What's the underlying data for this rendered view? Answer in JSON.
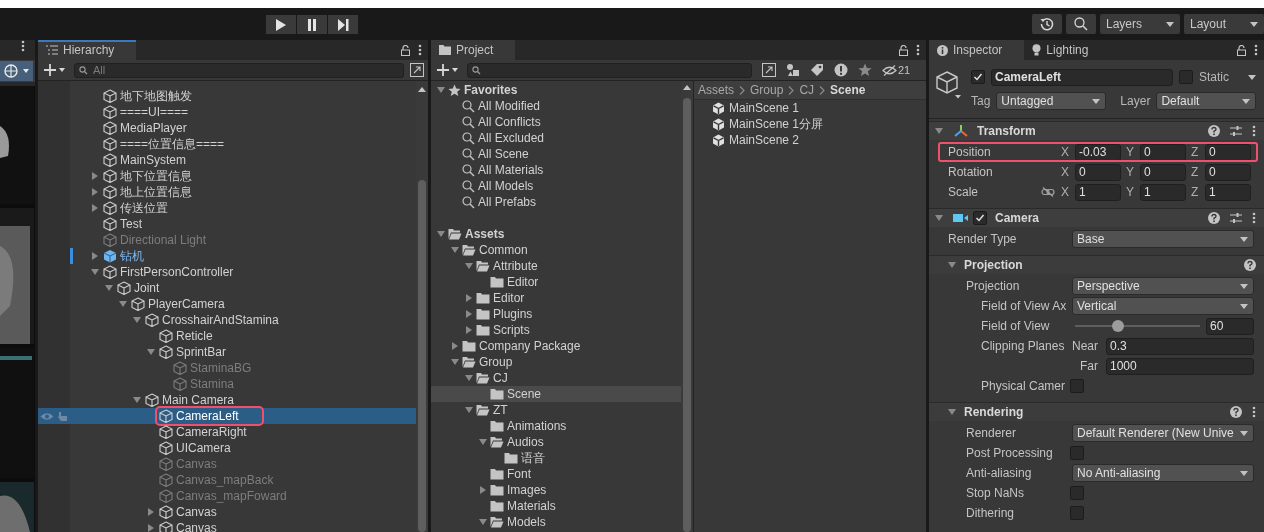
{
  "toolbar": {
    "play_buttons": [
      {
        "kind": "play",
        "selected": false
      },
      {
        "kind": "pause",
        "selected": false
      },
      {
        "kind": "step",
        "selected": false
      }
    ],
    "dropdowns": [
      "Layers",
      "Layout"
    ]
  },
  "hierarchy": {
    "title": "Hierarchy",
    "search": {
      "placeholder": "All"
    },
    "items": [
      {
        "name": "地下地图触发",
        "kind": "object",
        "disabled": false,
        "selected": false,
        "highlighted": false
      },
      {
        "name": "====UI====",
        "kind": "object",
        "disabled": false,
        "selected": false,
        "highlighted": false
      },
      {
        "name": "MediaPlayer",
        "kind": "object",
        "disabled": false,
        "selected": false,
        "highlighted": false
      },
      {
        "name": "====位置信息====",
        "kind": "object",
        "disabled": false,
        "selected": false,
        "highlighted": false
      },
      {
        "name": "MainSystem",
        "kind": "object",
        "disabled": false,
        "selected": false,
        "highlighted": false
      },
      {
        "name": "地下位置信息",
        "kind": "object",
        "expanded": false,
        "disabled": false,
        "selected": false,
        "highlighted": false
      },
      {
        "name": "地上位置信息",
        "kind": "object",
        "expanded": false,
        "disabled": false,
        "selected": false,
        "highlighted": false
      },
      {
        "name": "传送位置",
        "kind": "object",
        "expanded": false,
        "disabled": false,
        "selected": false,
        "highlighted": false
      },
      {
        "name": "Test",
        "kind": "object",
        "disabled": false,
        "selected": false,
        "highlighted": false
      },
      {
        "name": "Directional Light",
        "kind": "object",
        "disabled": true,
        "selected": false,
        "highlighted": false
      },
      {
        "name": "钻机",
        "kind": "prefab",
        "expanded": false,
        "disabled": false,
        "selected": false,
        "highlighted": false
      },
      {
        "name": "FirstPersonController",
        "kind": "object",
        "expanded": true,
        "disabled": false,
        "selected": false,
        "highlighted": false,
        "children": [
          {
            "name": "Joint",
            "kind": "object",
            "expanded": true,
            "disabled": false,
            "selected": false,
            "highlighted": false,
            "children": [
              {
                "name": "PlayerCamera",
                "kind": "object",
                "expanded": true,
                "disabled": false,
                "selected": false,
                "highlighted": false,
                "children": [
                  {
                    "name": "CrosshairAndStamina",
                    "kind": "object",
                    "expanded": true,
                    "disabled": false,
                    "selected": false,
                    "highlighted": false,
                    "children": [
                      {
                        "name": "Reticle",
                        "kind": "object",
                        "disabled": false,
                        "selected": false,
                        "highlighted": false
                      },
                      {
                        "name": "SprintBar",
                        "kind": "object",
                        "expanded": true,
                        "disabled": false,
                        "selected": false,
                        "highlighted": false,
                        "children": [
                          {
                            "name": "StaminaBG",
                            "kind": "object",
                            "disabled": true,
                            "selected": false,
                            "highlighted": false
                          },
                          {
                            "name": "Stamina",
                            "kind": "object",
                            "disabled": true,
                            "selected": false,
                            "highlighted": false
                          }
                        ]
                      }
                    ]
                  },
                  {
                    "name": "Main Camera",
                    "kind": "object",
                    "expanded": true,
                    "disabled": false,
                    "selected": false,
                    "highlighted": false,
                    "children": [
                      {
                        "name": "CameraLeft",
                        "kind": "object",
                        "disabled": false,
                        "selected": true,
                        "highlighted": true
                      },
                      {
                        "name": "CameraRight",
                        "kind": "object",
                        "disabled": false,
                        "selected": false,
                        "highlighted": false
                      },
                      {
                        "name": "UICamera",
                        "kind": "object",
                        "disabled": false,
                        "selected": false,
                        "highlighted": false
                      },
                      {
                        "name": "Canvas",
                        "kind": "object",
                        "disabled": true,
                        "selected": false,
                        "highlighted": false
                      },
                      {
                        "name": "Canvas_mapBack",
                        "kind": "object",
                        "disabled": true,
                        "selected": false,
                        "highlighted": false
                      },
                      {
                        "name": "Canvas_mapFoward",
                        "kind": "object",
                        "disabled": true,
                        "selected": false,
                        "highlighted": false
                      },
                      {
                        "name": "Canvas",
                        "kind": "object",
                        "expanded": false,
                        "disabled": false,
                        "selected": false,
                        "highlighted": false
                      },
                      {
                        "name": "Canvas",
                        "kind": "object",
                        "expanded": false,
                        "disabled": false,
                        "selected": false,
                        "highlighted": false
                      }
                    ]
                  }
                ]
              }
            ]
          }
        ]
      }
    ]
  },
  "project": {
    "title": "Project",
    "hidden_count": "21",
    "tree": [
      {
        "name": "Favorites",
        "kind": "favorites",
        "expanded": true,
        "selected": false,
        "children": [
          {
            "name": "All Modified",
            "kind": "search",
            "selected": false
          },
          {
            "name": "All Conflicts",
            "kind": "search",
            "selected": false
          },
          {
            "name": "All Excluded",
            "kind": "search",
            "selected": false
          },
          {
            "name": "All Scene",
            "kind": "search",
            "selected": false
          },
          {
            "name": "All Materials",
            "kind": "search",
            "selected": false
          },
          {
            "name": "All Models",
            "kind": "search",
            "selected": false
          },
          {
            "name": "All Prefabs",
            "kind": "search",
            "selected": false
          }
        ]
      },
      {
        "name": "Assets",
        "kind": "folder",
        "expanded": true,
        "selected": false,
        "children": [
          {
            "name": "Common",
            "kind": "folder",
            "expanded": true,
            "selected": false,
            "children": [
              {
                "name": "Attribute",
                "kind": "folder",
                "expanded": true,
                "selected": false,
                "children": [
                  {
                    "name": "Editor",
                    "kind": "folder",
                    "selected": false
                  }
                ]
              },
              {
                "name": "Editor",
                "kind": "folder",
                "expanded": false,
                "selected": false
              },
              {
                "name": "Plugins",
                "kind": "folder",
                "expanded": false,
                "selected": false
              },
              {
                "name": "Scripts",
                "kind": "folder",
                "expanded": false,
                "selected": false
              }
            ]
          },
          {
            "name": "Company Package",
            "kind": "folder",
            "expanded": false,
            "selected": false
          },
          {
            "name": "Group",
            "kind": "folder",
            "expanded": true,
            "selected": false,
            "children": [
              {
                "name": "CJ",
                "kind": "folder",
                "expanded": true,
                "selected": false,
                "children": [
                  {
                    "name": "Scene",
                    "kind": "folder",
                    "selected": true
                  }
                ]
              },
              {
                "name": "ZT",
                "kind": "folder",
                "expanded": true,
                "selected": false,
                "children": [
                  {
                    "name": "Animations",
                    "kind": "folder",
                    "selected": false
                  },
                  {
                    "name": "Audios",
                    "kind": "folder",
                    "expanded": true,
                    "selected": false,
                    "children": [
                      {
                        "name": "语音",
                        "kind": "folder",
                        "selected": false
                      }
                    ]
                  },
                  {
                    "name": "Font",
                    "kind": "folder",
                    "selected": false
                  },
                  {
                    "name": "Images",
                    "kind": "folder",
                    "expanded": false,
                    "selected": false
                  },
                  {
                    "name": "Materials",
                    "kind": "folder",
                    "selected": false
                  },
                  {
                    "name": "Models",
                    "kind": "folder",
                    "expanded": true,
                    "selected": false
                  }
                ]
              }
            ]
          }
        ]
      }
    ],
    "breadcrumb": [
      "Assets",
      "Group",
      "CJ",
      "Scene"
    ],
    "files": [
      {
        "name": "MainScene 1",
        "kind": "scene"
      },
      {
        "name": "MainScene 1分屏",
        "kind": "scene"
      },
      {
        "name": "MainScene 2",
        "kind": "scene"
      }
    ]
  },
  "inspector": {
    "tabs": [
      {
        "label": "Inspector",
        "kind": "info",
        "selected": true
      },
      {
        "label": "Lighting",
        "kind": "light",
        "selected": false
      }
    ],
    "object": {
      "active": true,
      "name": "CameraLeft",
      "static": false,
      "static_label": "Static",
      "tag_label": "Tag",
      "tag": "Untagged",
      "layer_label": "Layer",
      "layer": "Default"
    },
    "sections": [
      {
        "kind": "transform",
        "title": "Transform",
        "menu": true,
        "rows": [
          {
            "kind": "vector",
            "label": "Position",
            "highlighted": true,
            "constrain_toggle": false,
            "fields": [
              {
                "axis": "X",
                "value": "-0.03"
              },
              {
                "axis": "Y",
                "value": "0"
              },
              {
                "axis": "Z",
                "value": "0"
              }
            ]
          },
          {
            "kind": "vector",
            "label": "Rotation",
            "highlighted": false,
            "constrain_toggle": false,
            "fields": [
              {
                "axis": "X",
                "value": "0"
              },
              {
                "axis": "Y",
                "value": "0"
              },
              {
                "axis": "Z",
                "value": "0"
              }
            ]
          },
          {
            "kind": "vector",
            "label": "Scale",
            "highlighted": false,
            "constrain_toggle": true,
            "fields": [
              {
                "axis": "X",
                "value": "1"
              },
              {
                "axis": "Y",
                "value": "1"
              },
              {
                "axis": "Z",
                "value": "1"
              }
            ]
          }
        ]
      },
      {
        "kind": "camera",
        "title": "Camera",
        "enabled": true,
        "menu": true,
        "rows": [
          {
            "kind": "dropdown",
            "label": "Render Type",
            "value": "Base"
          }
        ]
      },
      {
        "kind": "group",
        "title": "Projection",
        "menu": false,
        "rows": [
          {
            "kind": "dropdown",
            "label": "Projection",
            "value": "Perspective",
            "children": [
              {
                "kind": "dropdown",
                "label": "Field of View Ax",
                "value": "Vertical"
              },
              {
                "kind": "slider",
                "label": "Field of View",
                "level": 0.34,
                "value": "60"
              },
              {
                "kind": "clipping",
                "label": "Clipping Planes",
                "fields": [
                  {
                    "label": "Near",
                    "value": "0.3"
                  },
                  {
                    "label": "Far",
                    "value": "1000"
                  }
                ]
              },
              {
                "kind": "checkbox",
                "label": "Physical Camer",
                "checked": false
              }
            ]
          }
        ]
      },
      {
        "kind": "group",
        "title": "Rendering",
        "menu": true,
        "rows": [
          {
            "kind": "dropdown",
            "label": "Renderer",
            "value": "Default Renderer (New Unive"
          },
          {
            "kind": "checkbox",
            "label": "Post Processing",
            "checked": false
          },
          {
            "kind": "dropdown",
            "label": "Anti-aliasing",
            "value": "No Anti-aliasing"
          },
          {
            "kind": "checkbox",
            "label": "Stop NaNs",
            "checked": false
          },
          {
            "kind": "checkbox",
            "label": "Dithering",
            "checked": false
          }
        ]
      }
    ]
  }
}
